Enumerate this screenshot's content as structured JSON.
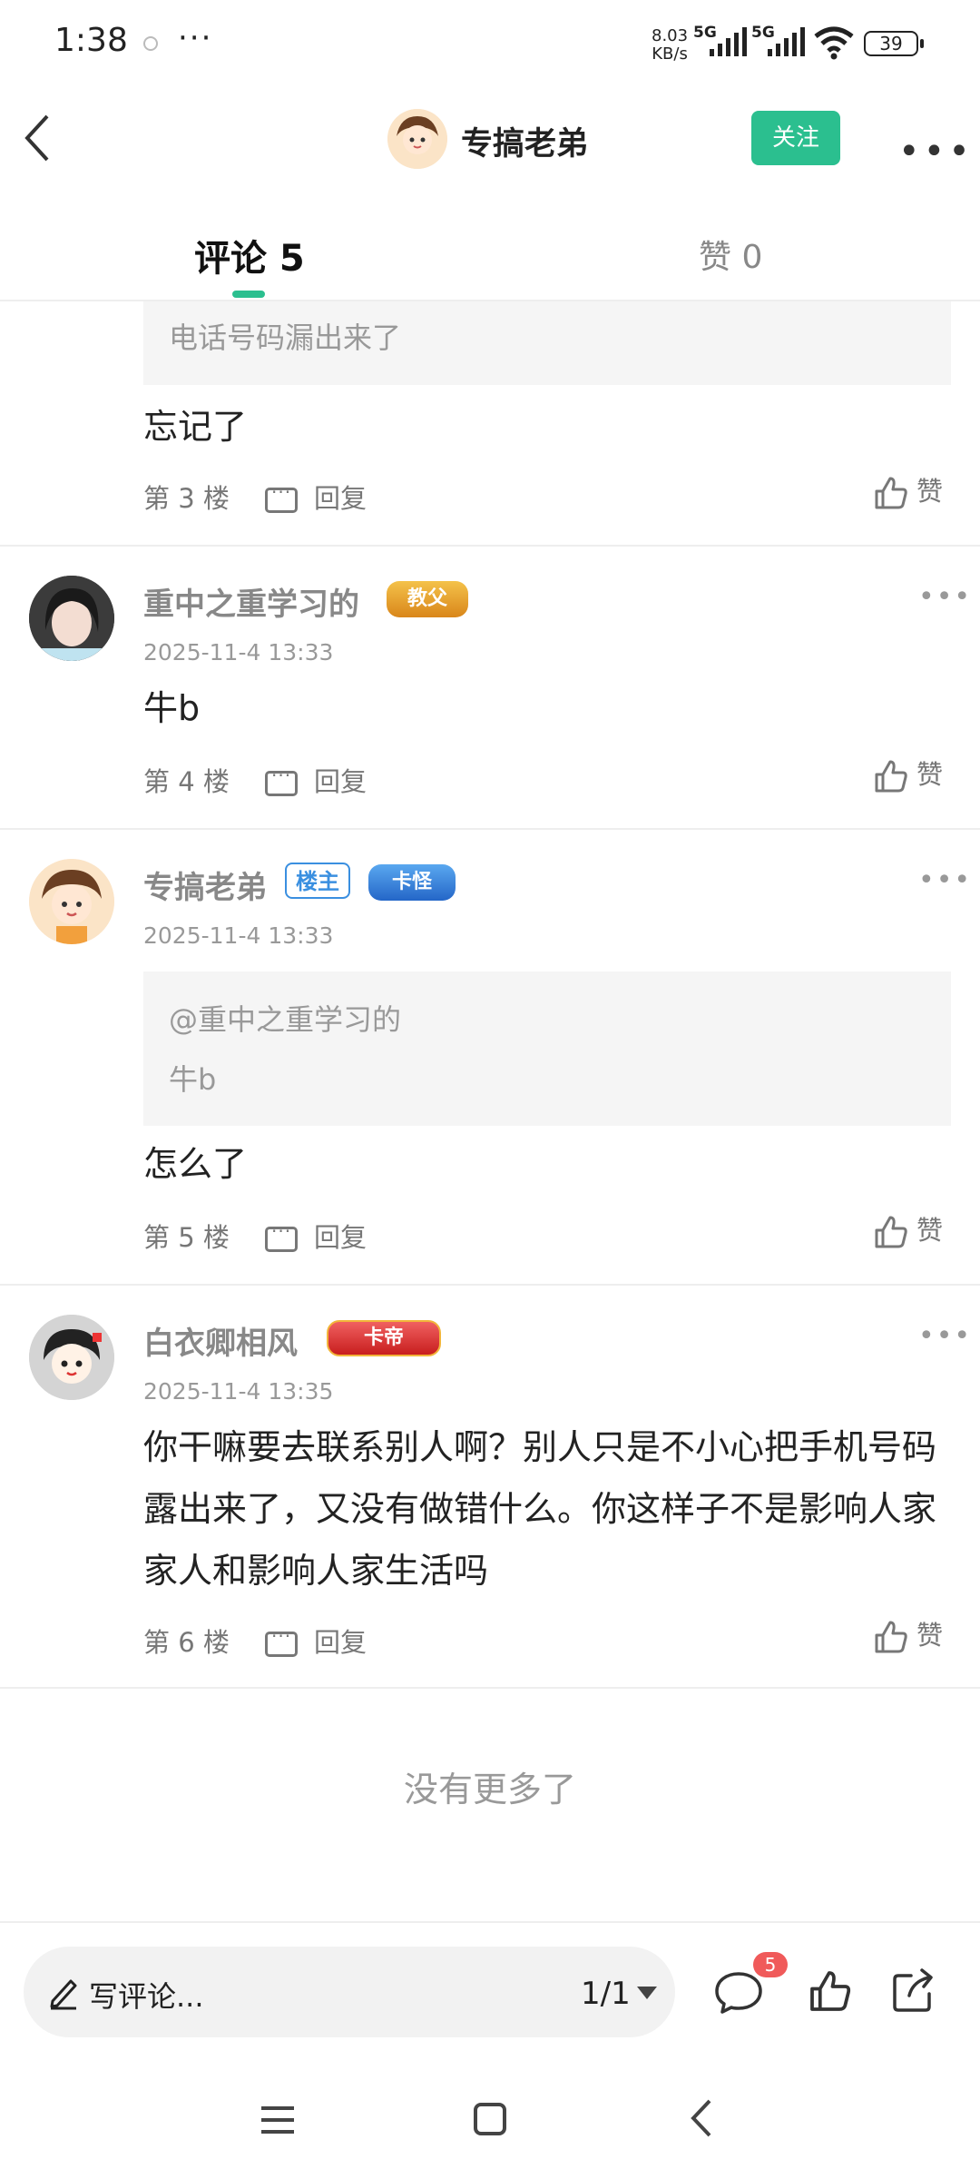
{
  "status_bar": {
    "time": "1:38",
    "dots": "···",
    "net_speed_value": "8.03",
    "net_speed_unit": "KB/s",
    "net1": "5G",
    "net2": "5G",
    "battery": "39"
  },
  "header": {
    "author_name": "专搞老弟",
    "follow_label": "关注"
  },
  "tabs": {
    "comments_label": "评论 5",
    "likes_label": "赞 0"
  },
  "comments": [
    {
      "quote_text": "电话号码漏出来了",
      "body": "忘记了",
      "floor": "第 3 楼",
      "reply_label": "回复",
      "like_label": "赞"
    },
    {
      "user": "重中之重学习的",
      "medal": "教父",
      "time": "2025-11-4 13:33",
      "body": "牛b",
      "floor": "第 4 楼",
      "reply_label": "回复",
      "like_label": "赞"
    },
    {
      "user": "专搞老弟",
      "host_badge": "楼主",
      "medal": "卡怪",
      "time": "2025-11-4 13:33",
      "quote_user": "@重中之重学习的",
      "quote_text": "牛b",
      "body": "怎么了",
      "floor": "第 5 楼",
      "reply_label": "回复",
      "like_label": "赞"
    },
    {
      "user": "白衣卿相风",
      "medal": "卡帝",
      "time": "2025-11-4 13:35",
      "body": "你干嘛要去联系别人啊？别人只是不小心把手机号码露出来了，又没有做错什么。你这样子不是影响人家家人和影响人家生活吗",
      "floor": "第 6 楼",
      "reply_label": "回复",
      "like_label": "赞"
    }
  ],
  "no_more_text": "没有更多了",
  "bottom_bar": {
    "write_placeholder": "写评论...",
    "page_indicator": "1/1",
    "comment_badge": "5"
  },
  "colors": {
    "accent": "#2bbf8f",
    "badge_red": "#f05a5a",
    "host_blue": "#3a8fe0"
  },
  "icons": [
    "back-arrow-icon",
    "more-icon",
    "reply-icon",
    "thumbs-up-icon",
    "pencil-icon",
    "comment-icon",
    "share-icon",
    "menu-icon",
    "home-icon",
    "nav-back-icon"
  ]
}
